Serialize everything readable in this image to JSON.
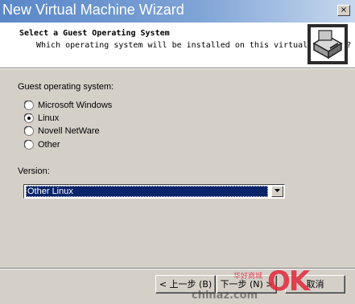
{
  "window": {
    "title": "New Virtual Machine Wizard",
    "close_glyph": "×"
  },
  "header": {
    "title": "Select a Guest Operating System",
    "subtitle": "Which operating system will be installed on this virtual machine?",
    "icon": "wizard-computer-icon"
  },
  "guest_os": {
    "label": "Guest operating system:",
    "options": [
      {
        "label": "Microsoft Windows",
        "selected": false
      },
      {
        "label": "Linux",
        "selected": true
      },
      {
        "label": "Novell NetWare",
        "selected": false
      },
      {
        "label": "Other",
        "selected": false
      }
    ]
  },
  "version": {
    "label": "Version:",
    "selected": "Other Linux"
  },
  "buttons": {
    "back": "< 上一步 (B)",
    "next": "下一步 (N) >",
    "cancel": "取消"
  },
  "watermark": {
    "ok": "OK",
    "cn": "华好商城",
    "site": "chinaz.com"
  },
  "colors": {
    "title_bar_start": "#5a87c8",
    "title_bar_end": "#c7d8ee",
    "selection": "#0a246a",
    "face": "#d4d0c8",
    "watermark_red": "#e3263a"
  }
}
